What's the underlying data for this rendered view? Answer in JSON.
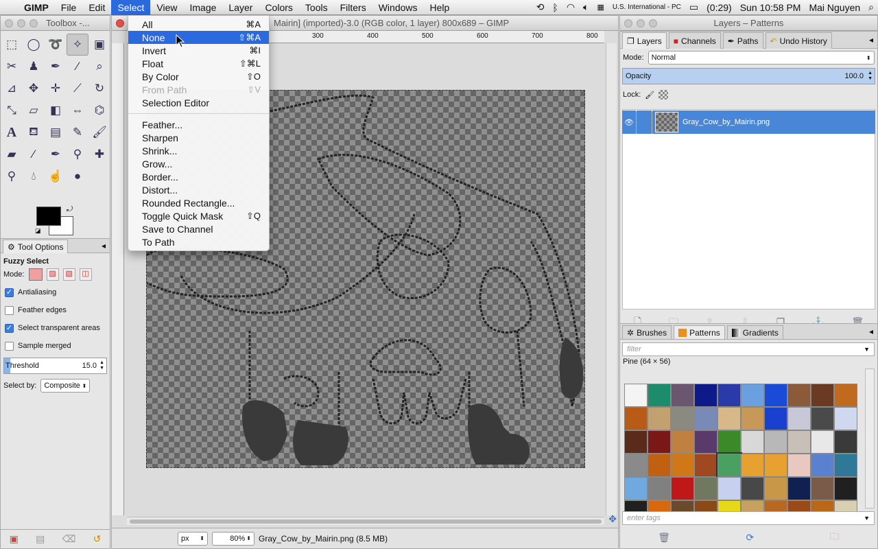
{
  "menubar": {
    "app": "GIMP",
    "items": [
      "File",
      "Edit",
      "Select",
      "View",
      "Image",
      "Layer",
      "Colors",
      "Tools",
      "Filters",
      "Windows",
      "Help"
    ],
    "active": "Select",
    "input_source": "U.S. International - PC",
    "battery": "(0:29)",
    "clock": "Sun 10:58 PM",
    "user": "Mai Nguyen"
  },
  "toolbox": {
    "title": "Toolbox -...",
    "tool_options_tab": "Tool Options",
    "tool_name": "Fuzzy Select",
    "mode_label": "Mode:",
    "antialiasing": "Antialiasing",
    "feather_edges": "Feather edges",
    "select_transparent": "Select transparent areas",
    "sample_merged": "Sample merged",
    "threshold_label": "Threshold",
    "threshold_value": "15.0",
    "threshold_fraction": 0.06,
    "select_by_label": "Select by:",
    "select_by_value": "Composite"
  },
  "image_window": {
    "title": "Mairin] (imported)-3.0 (RGB color, 1 layer) 800x689 – GIMP",
    "ruler_marks": [
      "300",
      "400",
      "500",
      "600",
      "700",
      "800"
    ],
    "unit": "px",
    "zoom": "80%",
    "status": "Gray_Cow_by_Mairin.png (8.5 MB)"
  },
  "select_menu": {
    "items": [
      {
        "label": "All",
        "shortcut": "⌘A"
      },
      {
        "label": "None",
        "shortcut": "⇧⌘A",
        "highlighted": true
      },
      {
        "label": "Invert",
        "shortcut": "⌘I"
      },
      {
        "label": "Float",
        "shortcut": "⇧⌘L"
      },
      {
        "label": "By Color",
        "shortcut": "⇧O"
      },
      {
        "label": "From Path",
        "shortcut": "⇧V",
        "disabled": true
      },
      {
        "label": "Selection Editor",
        "shortcut": ""
      },
      {
        "sep": true
      },
      {
        "label": "Feather...",
        "shortcut": ""
      },
      {
        "label": "Sharpen",
        "shortcut": ""
      },
      {
        "label": "Shrink...",
        "shortcut": ""
      },
      {
        "label": "Grow...",
        "shortcut": ""
      },
      {
        "label": "Border...",
        "shortcut": ""
      },
      {
        "label": "Distort...",
        "shortcut": ""
      },
      {
        "label": "Rounded Rectangle...",
        "shortcut": ""
      },
      {
        "label": "Toggle Quick Mask",
        "shortcut": "⇧Q"
      },
      {
        "label": "Save to Channel",
        "shortcut": ""
      },
      {
        "label": "To Path",
        "shortcut": ""
      }
    ]
  },
  "dock": {
    "title": "Layers – Patterns",
    "tabs": [
      "Layers",
      "Channels",
      "Paths",
      "Undo History"
    ],
    "mode_label": "Mode:",
    "mode_value": "Normal",
    "opacity_label": "Opacity",
    "opacity_value": "100.0",
    "lock_label": "Lock:",
    "layer_name": "Gray_Cow_by_Mairin.png",
    "bottom_tabs": [
      "Brushes",
      "Patterns",
      "Gradients"
    ],
    "filter_placeholder": "filter",
    "pattern_info": "Pine (64 × 56)",
    "tags_placeholder": "enter tags"
  },
  "colors": {
    "accent": "#2b6ade",
    "layer_selected": "#4a86d8",
    "fg": "#000000",
    "bg": "#ffffff"
  },
  "patterns": [
    "#f4f4f4",
    "#1d8c6a",
    "#6b5670",
    "#0f1a8a",
    "#2a3aa8",
    "#6a9fe0",
    "#1a4ad8",
    "#8a5a3a",
    "#6a3a22",
    "#c06a20",
    "#b85a18",
    "#c2a070",
    "#8a8a80",
    "#7a8ab8",
    "#d8b888",
    "#c89858",
    "#1a40d0",
    "#c8c8d8",
    "#4a4a4a",
    "#d0d8f0",
    "#5a2a1a",
    "#7a1818",
    "#c08040",
    "#5a3a6a",
    "#3a8a2a",
    "#d8d8d8",
    "#b8b8b8",
    "#c8c0b8",
    "#e8e8e8",
    "#3a3a3a",
    "#8a8a8a",
    "#c06010",
    "#d07818",
    "#a04820",
    "#4aa060",
    "#e8a030",
    "#e8a030",
    "#e8c8c0",
    "#5a80d0",
    "#307898",
    "#70a8e0",
    "#808080",
    "#c01818",
    "#707860",
    "#c8d0f0",
    "#484848",
    "#c89848",
    "#102050",
    "#7a5a48",
    "#202020",
    "#202020",
    "#d86810",
    "#6a4a2a",
    "#8a4a18",
    "#e8d818",
    "#c8a060",
    "#b86820",
    "#9a4a18",
    "#b86818",
    "#d8d0b0"
  ],
  "selected_pattern": 34
}
